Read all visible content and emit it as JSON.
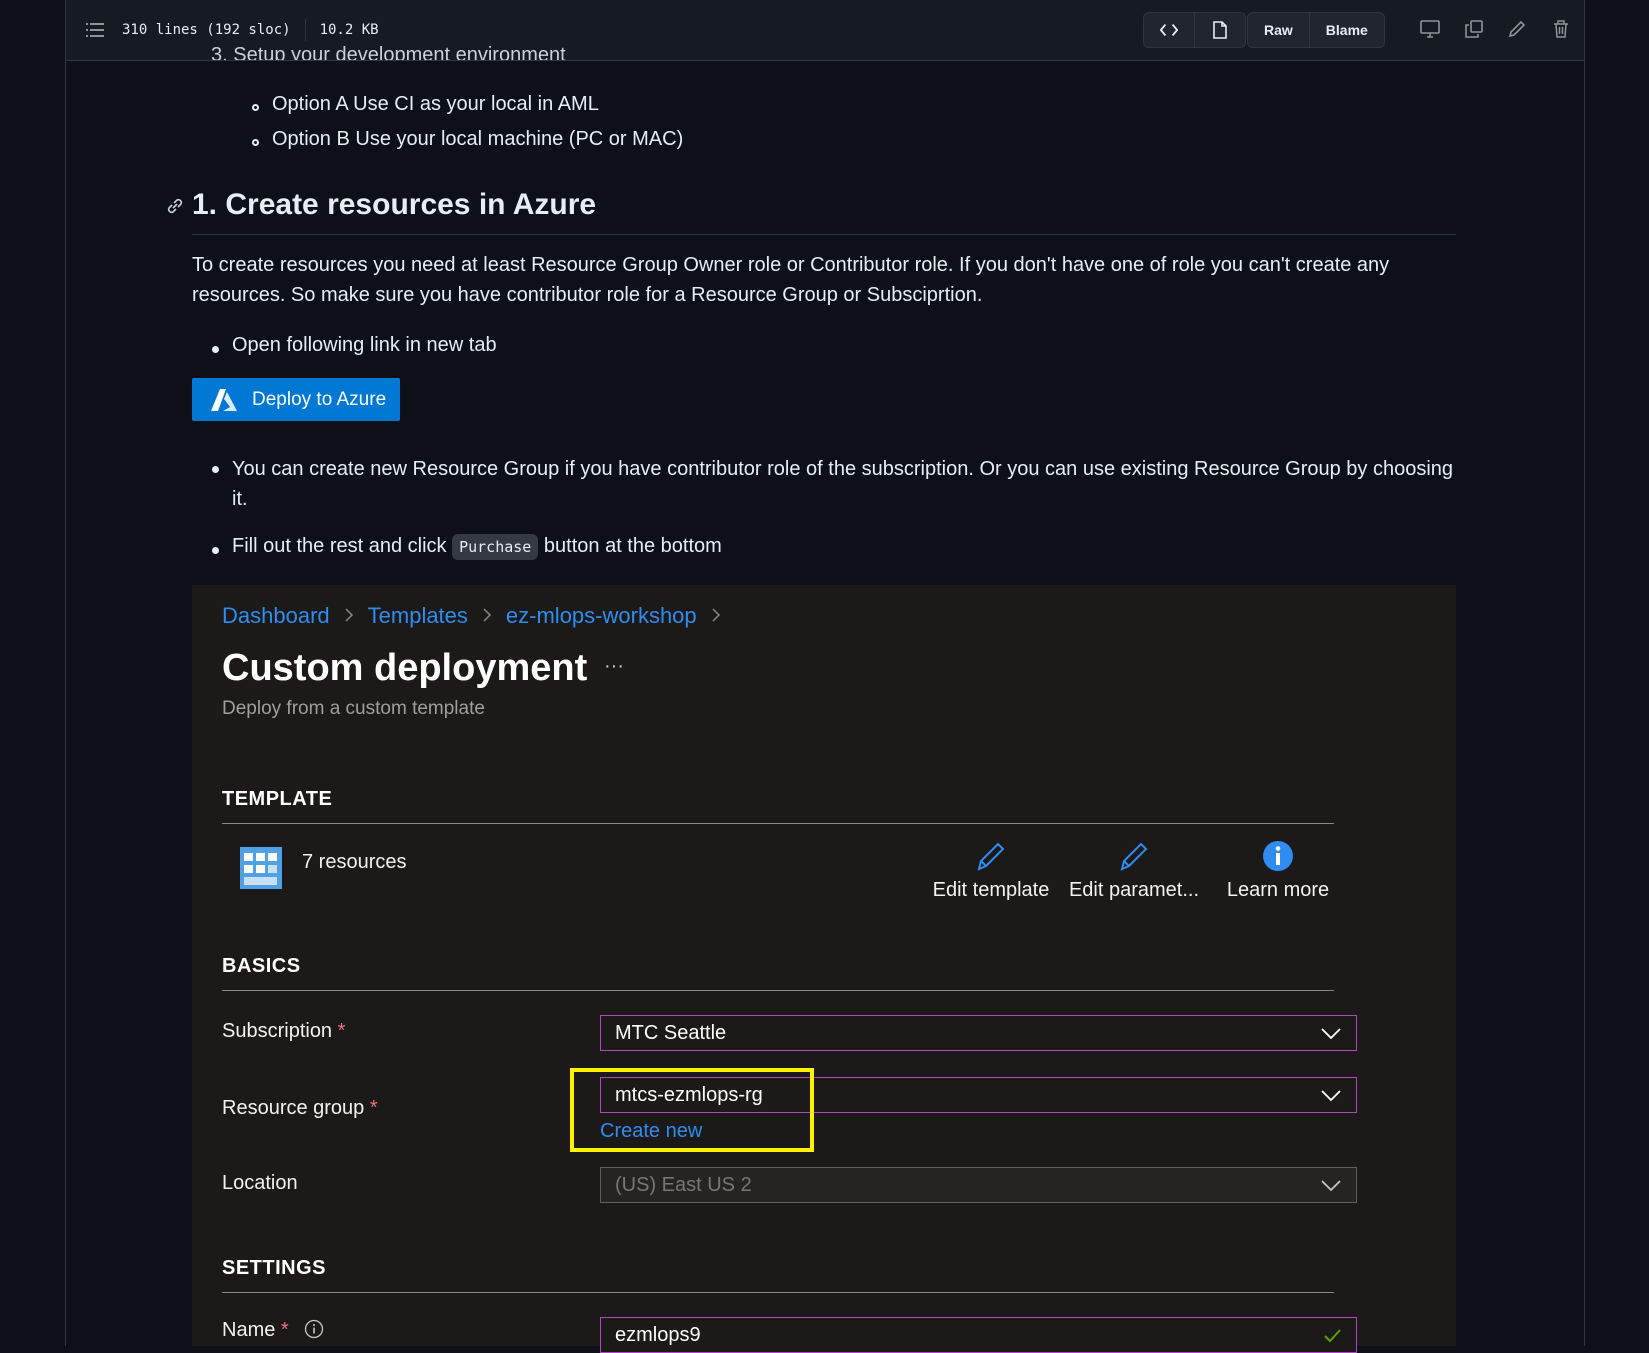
{
  "filebar": {
    "lines": "310 lines (192 sloc)",
    "size": "10.2 KB",
    "raw": "Raw",
    "blame": "Blame"
  },
  "content": {
    "cut_line": "3. Setup your development environment",
    "sub_items": [
      "Option A Use CI as your local in AML",
      "Option B Use your local machine (PC or MAC)"
    ],
    "heading": "1. Create resources in Azure",
    "paragraph_line1": "To create resources you need at least Resource Group Owner role or Contributor role. If you don't have one of role you can't create any",
    "paragraph_line2": "resources. So make sure you have contributor role for a Resource Group or Subsciprtion.",
    "bullet1": "Open following link in new tab",
    "deploy_button": "Deploy to Azure",
    "bullet2_line1": "You can create new Resource Group if you have contributor role of the subscription. Or you can use existing Resource Group by choosing",
    "bullet2_line2": "it.",
    "bullet3_before": "Fill out the rest and click",
    "bullet3_code": "Purchase",
    "bullet3_after": "button at the bottom"
  },
  "azure": {
    "breadcrumb": [
      "Dashboard",
      "Templates",
      "ez-mlops-workshop"
    ],
    "title": "Custom deployment",
    "more": "···",
    "subtitle": "Deploy from a custom template",
    "template_section": "TEMPLATE",
    "resources": "7 resources",
    "actions": [
      "Edit template",
      "Edit paramet...",
      "Learn more"
    ],
    "basics_section": "BASICS",
    "subscription_label": "Subscription",
    "subscription_value": "MTC Seattle",
    "rg_label": "Resource group",
    "rg_value": "mtcs-ezmlops-rg",
    "create_new": "Create new",
    "location_label": "Location",
    "location_value": "(US) East US 2",
    "settings_section": "SETTINGS",
    "name_label": "Name",
    "name_value": "ezmlops9",
    "required_mark": "*",
    "colors": {
      "accent": "#0078d4",
      "link": "#2f8cf0",
      "highlight": "#fff200",
      "focus_border": "#b146c2"
    }
  }
}
